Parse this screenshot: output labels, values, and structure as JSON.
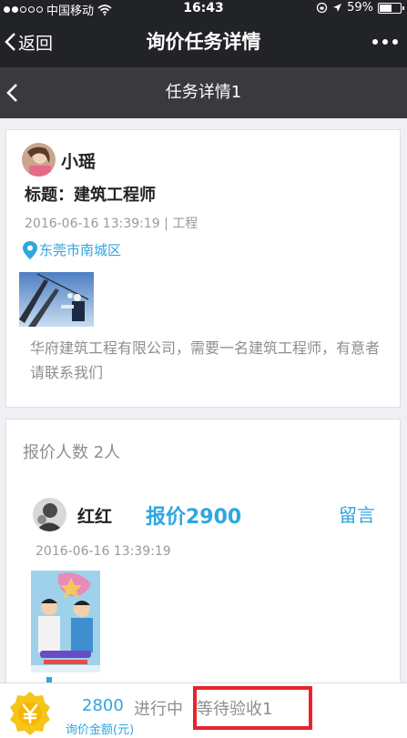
{
  "status_bar": {
    "carrier": "中国移动",
    "time": "16:43",
    "battery": "59%",
    "battery_level": 0.59
  },
  "nav": {
    "back_label": "返回",
    "title": "询价任务详情"
  },
  "sub_nav": {
    "title": "任务详情1"
  },
  "task": {
    "user_name": "小瑶",
    "title": "标题：建筑工程师",
    "meta": "2016-06-16 13:39:19 | 工程",
    "location": "东莞市南城区",
    "description": "华府建筑工程有限公司，需要一名建筑工程师，有意者请联系我们"
  },
  "quotes": {
    "count_label": "报价人数 2人",
    "items": [
      {
        "name": "红红",
        "offer": "报价2900",
        "action": "留言",
        "timestamp": "2016-06-16 13:39:19"
      }
    ]
  },
  "bottom": {
    "amount": "2800",
    "amount_label": "询价金额(元)",
    "status_progress": "进行中",
    "status_await": "等待验收1"
  },
  "colors": {
    "accent": "#2ea6e0",
    "dark_nav": "#222327",
    "highlight_box": "#e8242d"
  }
}
